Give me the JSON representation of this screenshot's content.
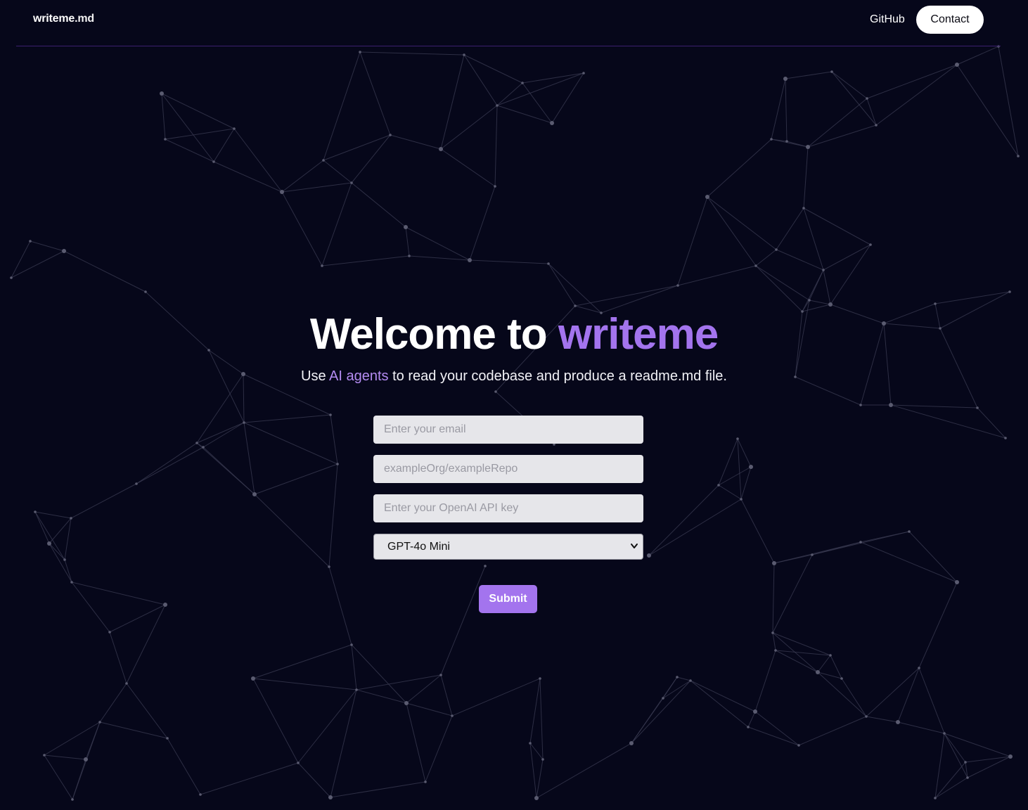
{
  "header": {
    "logo_main": "writeme",
    "logo_ext": ".md",
    "github_label": "GitHub",
    "contact_label": "Contact"
  },
  "hero": {
    "title_prefix": "Welcome to",
    "title_accent": "writeme",
    "subtitle_before": "Use",
    "subtitle_accent": "AI agents",
    "subtitle_after": "to read your codebase and produce a readme.md file."
  },
  "form": {
    "email_placeholder": "Enter your email",
    "repo_placeholder": "exampleOrg/exampleRepo",
    "apikey_placeholder": "Enter your OpenAI API key",
    "model_selected": "GPT-4o Mini",
    "submit_label": "Submit"
  },
  "colors": {
    "background": "#06071a",
    "accent": "#a374ee",
    "network_lines": "#3a3b52",
    "network_nodes": "#5a5b70"
  },
  "icons": {
    "select_chevron": "chevron-down-icon"
  }
}
